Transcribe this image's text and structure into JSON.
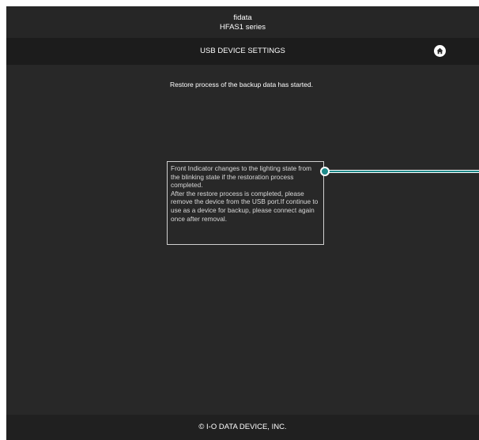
{
  "header": {
    "brand": "fidata",
    "model": "HFAS1 series"
  },
  "titlebar": {
    "title": "USB DEVICE SETTINGS",
    "home_icon": "home-icon"
  },
  "main": {
    "message": "Restore process of the backup data has started.",
    "info_text": "Front Indicator changes to the lighting state from the blinking state if the restoration process completed.\nAfter the restore process is completed, please remove the device from the USB port.If continue to use as a device for backup, please connect again once after removal."
  },
  "footer": {
    "copyright": "© I-O DATA DEVICE, INC."
  },
  "colors": {
    "background": "#282828",
    "titlebar": "#1c1c1c",
    "callout_line": "#1f8a8a"
  }
}
